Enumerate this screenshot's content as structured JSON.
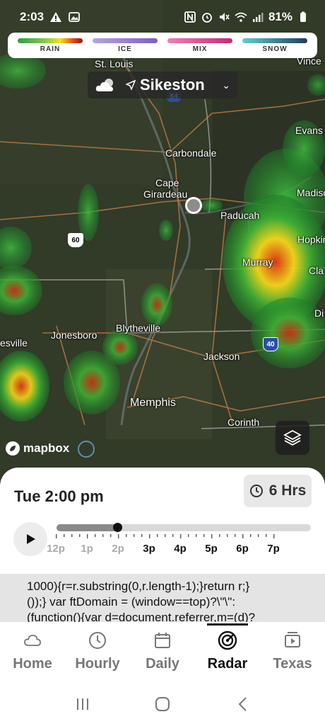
{
  "status": {
    "time": "2:03",
    "battery": "81%"
  },
  "legend": [
    {
      "label": "RAIN",
      "color": "linear-gradient(90deg,#2e9e3e 0%,#7cc94c 40%,#f2e31a 65%,#e64b1a 85%,#9b1010 100%)"
    },
    {
      "label": "ICE",
      "color": "linear-gradient(90deg,#b7a3e3,#7d5fc4)"
    },
    {
      "label": "MIX",
      "color": "linear-gradient(90deg,#f07fb5,#c42a75)"
    },
    {
      "label": "SNOW",
      "color": "linear-gradient(90deg,#5dd0d6,#1f3d5e)"
    }
  ],
  "location": {
    "name": "Sikeston"
  },
  "map_labels": {
    "st_louis": "St. Louis",
    "carbondale": "Carbondale",
    "cape_girardeau_1": "Cape",
    "cape_girardeau_2": "Girardeau",
    "paducah": "Paducah",
    "evansville": "Evans",
    "madisonville": "Madiso",
    "hopkinsville": "Hopkin",
    "murray": "Murray",
    "clarksville": "Cla",
    "dickson": "Di",
    "jonesboro": "Jonesboro",
    "blytheville": "Blytheville",
    "jackson": "Jackson",
    "memphis": "Memphis",
    "corinth": "Corinth",
    "batesville": "esville",
    "vincennes": "Vince",
    "hwy_60": "60",
    "hwy_40": "40",
    "hwy_64": "64",
    "mapbox": "mapbox"
  },
  "timeline": {
    "title": "Tue 2:00 pm",
    "range_label": "6 Hrs",
    "progress": 0.24,
    "ticks": [
      {
        "label": "12p",
        "past": true
      },
      {
        "label": "1p",
        "past": true
      },
      {
        "label": "2p",
        "past": true
      },
      {
        "label": "3p",
        "past": false
      },
      {
        "label": "4p",
        "past": false
      },
      {
        "label": "5p",
        "past": false
      },
      {
        "label": "6p",
        "past": false
      },
      {
        "label": "7p",
        "past": false
      }
    ]
  },
  "code_text": {
    "line1": "1000){r=r.substring(0,r.length-1);}return r;}",
    "line2": "());} var ftDomain = (window==top)?\\\"\\\":",
    "line3": "(function(){var d=document.referrer,m=(d)?"
  },
  "tabs": [
    {
      "label": "Home",
      "icon": "cloud-icon",
      "active": false
    },
    {
      "label": "Hourly",
      "icon": "clock-icon",
      "active": false
    },
    {
      "label": "Daily",
      "icon": "calendar-icon",
      "active": false
    },
    {
      "label": "Radar",
      "icon": "radar-icon",
      "active": true
    },
    {
      "label": "Texas",
      "icon": "video-icon",
      "active": false
    }
  ]
}
